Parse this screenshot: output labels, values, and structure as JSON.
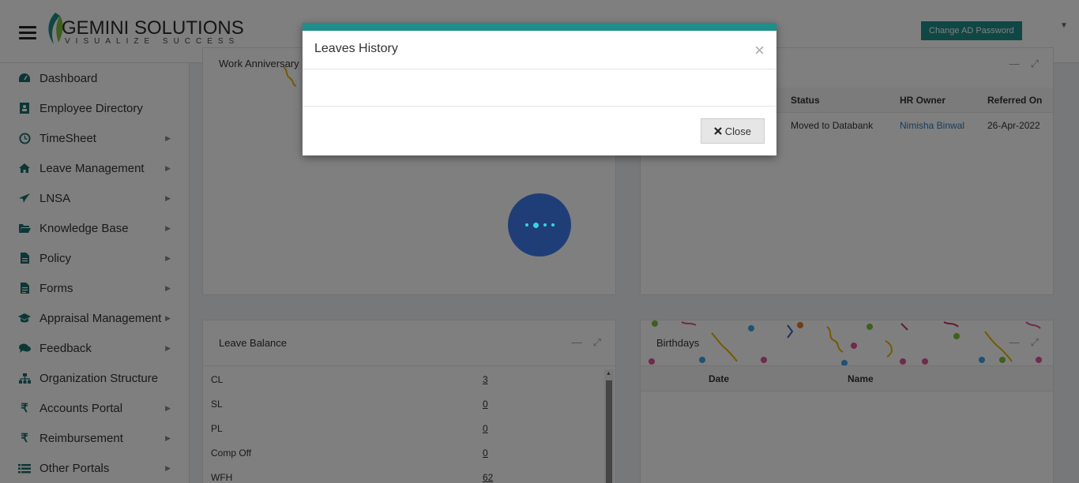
{
  "header": {
    "logo_title": "GEMINI SOLUTIONS",
    "logo_tagline": "VISUALIZE SUCCESS",
    "change_password_label": "Change AD Password"
  },
  "sidebar": {
    "items": [
      {
        "label": "Dashboard",
        "icon": "dashboard-icon",
        "submenu": false
      },
      {
        "label": "Employee Directory",
        "icon": "directory-icon",
        "submenu": false
      },
      {
        "label": "TimeSheet",
        "icon": "clock-icon",
        "submenu": true
      },
      {
        "label": "Leave Management",
        "icon": "home-icon",
        "submenu": true
      },
      {
        "label": "LNSA",
        "icon": "paper-plane-icon",
        "submenu": true
      },
      {
        "label": "Knowledge Base",
        "icon": "folder-open-icon",
        "submenu": true
      },
      {
        "label": "Policy",
        "icon": "file-icon",
        "submenu": true
      },
      {
        "label": "Forms",
        "icon": "file-text-icon",
        "submenu": true
      },
      {
        "label": "Appraisal Management",
        "icon": "graduation-cap-icon",
        "submenu": true
      },
      {
        "label": "Feedback",
        "icon": "comments-icon",
        "submenu": true
      },
      {
        "label": "Organization Structure",
        "icon": "sitemap-icon",
        "submenu": false
      },
      {
        "label": "Accounts Portal",
        "icon": "rupee-icon",
        "submenu": true
      },
      {
        "label": "Reimbursement",
        "icon": "rupee-icon",
        "submenu": true
      },
      {
        "label": "Other Portals",
        "icon": "list-icon",
        "submenu": true
      }
    ]
  },
  "work_anniversary": {
    "title": "Work Anniversary"
  },
  "referrals": {
    "headers": [
      "Status",
      "HR Owner",
      "Referred On"
    ],
    "rows": [
      {
        "status": "Moved to Databank",
        "hr_owner": "Nimisha Binwal",
        "referred_on": "26-Apr-2022"
      }
    ]
  },
  "leave_balance": {
    "title": "Leave Balance",
    "rows": [
      {
        "type": "CL",
        "value": "3"
      },
      {
        "type": "SL",
        "value": "0"
      },
      {
        "type": "PL",
        "value": "0"
      },
      {
        "type": "Comp Off",
        "value": "0"
      },
      {
        "type": "WFH",
        "value": "62"
      }
    ]
  },
  "birthdays": {
    "title": "Birthdays",
    "headers": [
      "Date",
      "Name"
    ]
  },
  "modal": {
    "title": "Leaves History",
    "close_x": "×",
    "close_label": "Close"
  },
  "colors": {
    "accent": "#1f8e8a",
    "link": "#2a7ab8",
    "spinner_bg": "#1f3e78",
    "spinner_dot": "#38d3e0"
  }
}
